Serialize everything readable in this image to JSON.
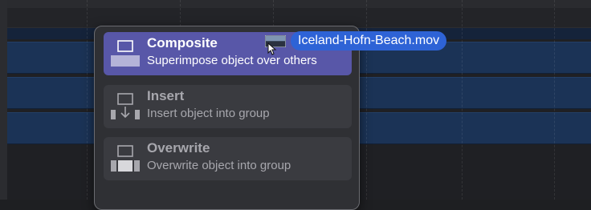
{
  "colors": {
    "timeline_bg": "#1f2024",
    "track_blue": "#1b3356",
    "popover_bg": "#2f3034",
    "option_bg": "#3a3b40",
    "selected_bg": "#5857a8",
    "drag_pill": "#2e63d6",
    "text_dim": "#a7a7ad",
    "text_bright": "#ffffff"
  },
  "drop_menu": {
    "options": [
      {
        "title": "Composite",
        "subtitle": "Superimpose object over others",
        "icon": "composite-icon",
        "selected": true
      },
      {
        "title": "Insert",
        "subtitle": "Insert object into group",
        "icon": "insert-icon",
        "selected": false
      },
      {
        "title": "Overwrite",
        "subtitle": "Overwrite object into group",
        "icon": "overwrite-icon",
        "selected": false
      }
    ]
  },
  "drag": {
    "filename": "Iceland-Hofn-Beach.mov",
    "thumbnail_icon": "video-thumbnail-icon",
    "cursor_icon": "drag-copy-cursor-icon"
  }
}
